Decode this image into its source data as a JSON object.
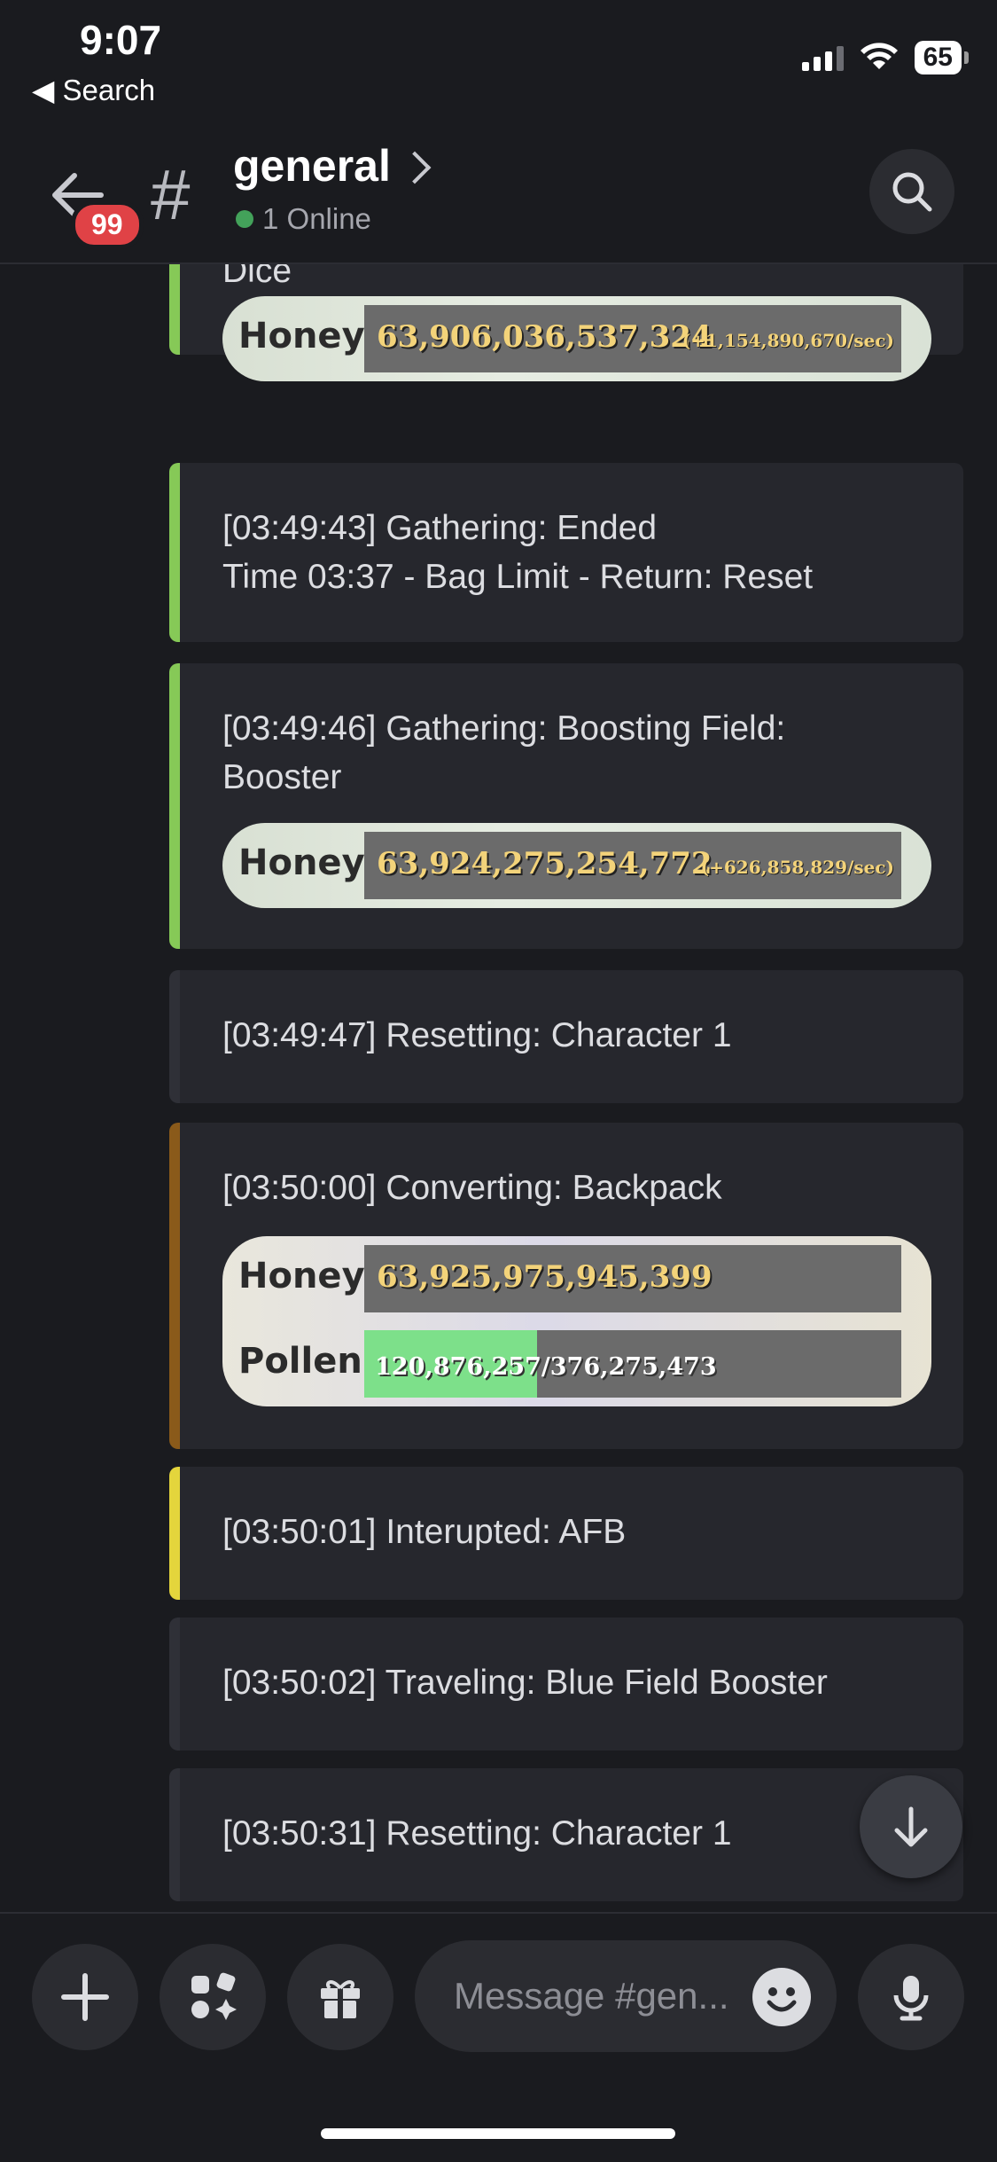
{
  "status_bar": {
    "time": "9:07",
    "back_label": "◀ Search",
    "battery": "65"
  },
  "header": {
    "badge_count": "99",
    "channel_name": "general",
    "online_text": "1 Online"
  },
  "messages": [
    {
      "text": "Dice",
      "accent": "#86c957",
      "stat": {
        "label": "Honey",
        "value": "63,906,036,537,324",
        "rate": "(+1,154,890,670/sec)"
      }
    },
    {
      "text": "[03:49:43] Gathering: Ended\nTime 03:37 - Bag Limit - Return: Reset",
      "accent": "#86c957"
    },
    {
      "text": "[03:49:46] Gathering: Boosting Field:\nBooster",
      "accent": "#86c957",
      "stat": {
        "label": "Honey",
        "value": "63,924,275,254,772",
        "rate": "(+626,858,829/sec)"
      }
    },
    {
      "text": "[03:49:47] Resetting: Character 1",
      "accent": "#2f3037"
    },
    {
      "text": "[03:50:00] Converting: Backpack",
      "accent": "#8a5a1a",
      "stat": {
        "label": "Honey",
        "value": "63,925,975,945,399"
      },
      "stat2": {
        "label": "Pollen",
        "value": "120,876,257/376,275,473",
        "fill": 0.321
      }
    },
    {
      "text": "[03:50:01] Interupted: AFB",
      "accent": "#e4d53c"
    },
    {
      "text": "[03:50:02] Traveling: Blue Field Booster",
      "accent": "#2f3037"
    },
    {
      "text": "[03:50:31] Resetting: Character 1",
      "accent": "#2f3037"
    }
  ],
  "composer": {
    "placeholder": "Message #gen..."
  },
  "icons": {
    "back": "arrow-left-icon",
    "hash": "hash-icon",
    "search": "search-icon",
    "scroll": "arrow-down-icon",
    "plus": "plus-icon",
    "apps": "apps-icon",
    "gift": "gift-icon",
    "emoji": "emoji-icon",
    "mic": "microphone-icon"
  }
}
